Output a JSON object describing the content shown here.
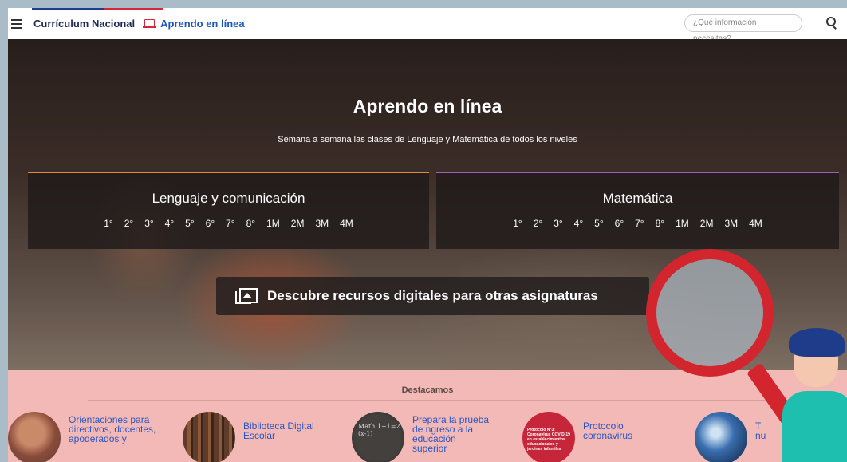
{
  "topbar": {
    "brand": "Currículum Nacional",
    "section_link": "Aprendo en línea",
    "search_placeholder": "¿Qué información necesitas?",
    "icons": [
      "menu-icon",
      "laptop-icon",
      "search-icon"
    ]
  },
  "hero": {
    "title": "Aprendo en línea",
    "subtitle": "Semana a semana las clases de Lenguaje y Matemática de todos los niveles",
    "subjects": [
      {
        "title": "Lenguaje y comunicación",
        "accent": "#e08a3c",
        "grades": [
          "1°",
          "2°",
          "3°",
          "4°",
          "5°",
          "6°",
          "7°",
          "8°",
          "1M",
          "2M",
          "3M",
          "4M"
        ]
      },
      {
        "title": "Matemática",
        "accent": "#a25fb0",
        "grades": [
          "1°",
          "2°",
          "3°",
          "4°",
          "5°",
          "6°",
          "7°",
          "8°",
          "1M",
          "2M",
          "3M",
          "4M"
        ]
      }
    ],
    "discover_label": "Descubre recursos digitales para otras asignaturas"
  },
  "destacamos": {
    "title": "Destacamos",
    "items": [
      {
        "label": "Orientaciones para directivos, docentes, apoderados y"
      },
      {
        "label": "Biblioteca Digital Escolar"
      },
      {
        "label": "Prepara la prueba de ngreso a la educación superior",
        "image_text": "Math  1+1=2  (x-1)"
      },
      {
        "label": "Protocolo coronavirus",
        "image_text": "Protocolo N°3: Coronavirus COVID-19 en establecimientos educacionales y jardines infantiles"
      },
      {
        "label": "T nu"
      }
    ]
  },
  "colors": {
    "brand_blue": "#1d2b55",
    "link_blue": "#1d57b8",
    "accent_red": "#d6263a",
    "destacamos_bg": "#f2b9b6"
  }
}
